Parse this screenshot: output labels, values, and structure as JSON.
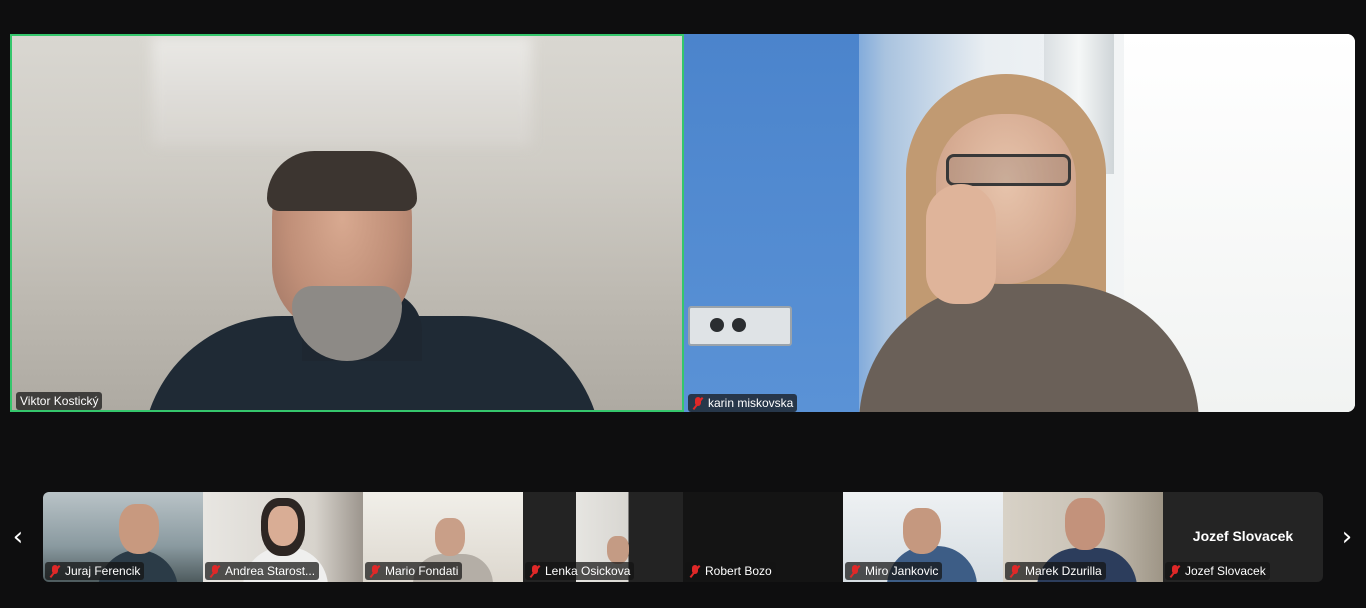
{
  "main_tiles": [
    {
      "name": "Viktor Kostický",
      "muted": false,
      "active_speaker": true
    },
    {
      "name": "karin miskovska",
      "muted": true,
      "active_speaker": false
    }
  ],
  "thumbnails": [
    {
      "name": "Juraj Ferencik",
      "muted": true,
      "video": true
    },
    {
      "name": "Andrea Starost...",
      "muted": true,
      "video": true
    },
    {
      "name": "Mario Fondati",
      "muted": true,
      "video": true
    },
    {
      "name": "Lenka Osickova",
      "muted": true,
      "video": true
    },
    {
      "name": "Robert Bozo",
      "muted": true,
      "video": false
    },
    {
      "name": "Miro Jankovic",
      "muted": true,
      "video": true
    },
    {
      "name": "Marek Dzurilla",
      "muted": true,
      "video": true
    },
    {
      "name": "Jozef Slovacek",
      "muted": true,
      "video": false,
      "placeholder_text": "Jozef Slovacek"
    }
  ],
  "nav": {
    "prev_icon": "chevron-left-icon",
    "next_icon": "chevron-right-icon",
    "prev_glyph": "‹",
    "next_glyph": "›"
  },
  "colors": {
    "active_speaker_border": "#35c66c",
    "muted_icon": "#e02828",
    "background": "#0e0e0f"
  }
}
